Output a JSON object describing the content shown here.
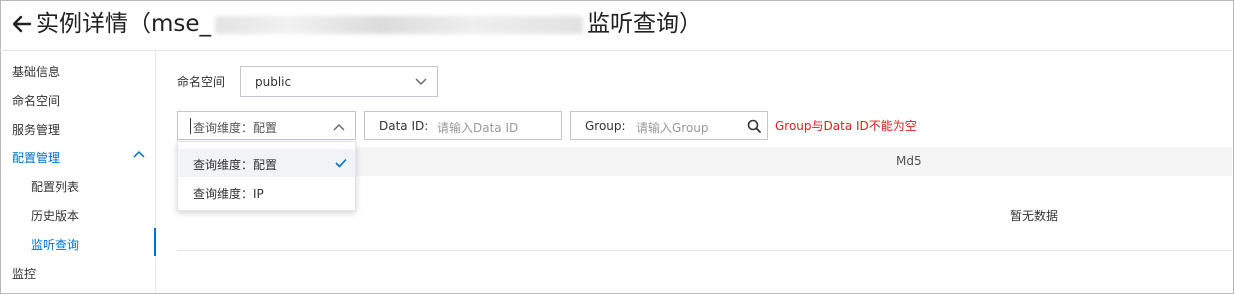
{
  "header": {
    "title_prefix": "实例详情（mse_",
    "title_suffix": "监听查询）"
  },
  "sidebar": {
    "items": [
      {
        "label": "基础信息"
      },
      {
        "label": "命名空间"
      },
      {
        "label": "服务管理"
      },
      {
        "label": "配置管理"
      },
      {
        "label": "配置列表"
      },
      {
        "label": "历史版本"
      },
      {
        "label": "监听查询"
      },
      {
        "label": "监控"
      }
    ]
  },
  "filters": {
    "namespace_label": "命名空间",
    "namespace_value": "public",
    "dimension_value": "查询维度：配置",
    "dataid_label": "Data ID:",
    "dataid_placeholder": "请输入Data ID",
    "group_label": "Group:",
    "group_placeholder": "请输入Group",
    "error_message": "Group与Data ID不能为空"
  },
  "dropdown": {
    "options": [
      {
        "label": "查询维度：配置"
      },
      {
        "label": "查询维度：IP"
      }
    ]
  },
  "table": {
    "column_md5": "Md5",
    "empty_text": "暂无数据"
  },
  "colors": {
    "accent": "#0070cc",
    "error": "#e02020"
  },
  "icons": {
    "back": "arrow-left-icon",
    "search": "search-icon",
    "check": "check-icon",
    "chevron": "chevron-down-icon"
  }
}
